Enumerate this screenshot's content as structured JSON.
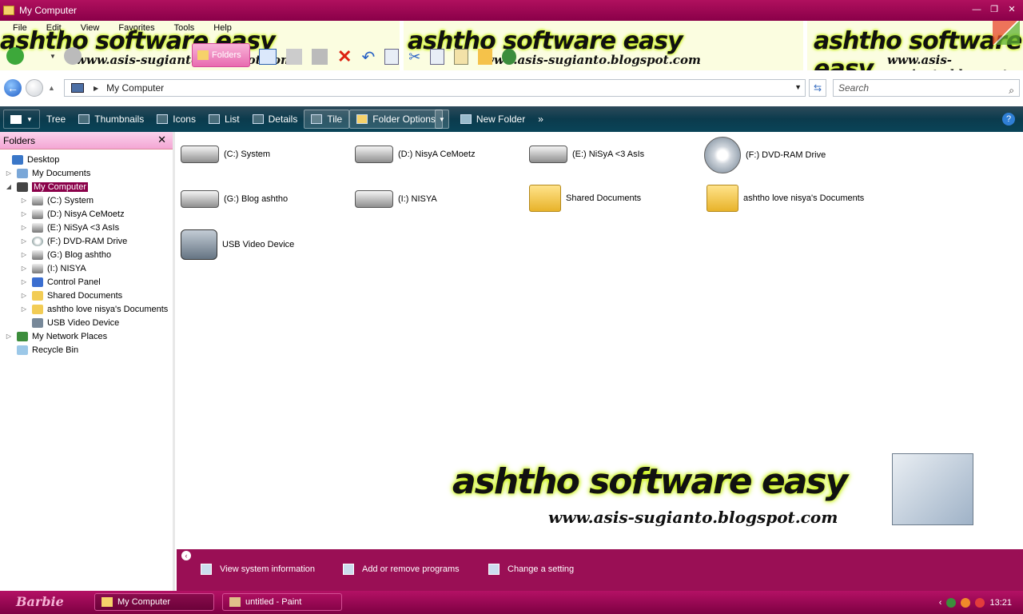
{
  "window": {
    "title": "My Computer"
  },
  "menu": [
    "File",
    "Edit",
    "View",
    "Favorites",
    "Tools",
    "Help"
  ],
  "toolbar": {
    "folders_label": "Folders"
  },
  "banner": {
    "text": "ashtho software easy",
    "url": "www.asis-sugianto.blogspot.com"
  },
  "address": {
    "path": "My Computer",
    "search_placeholder": "Search"
  },
  "commandbar": {
    "items": [
      "Tree",
      "Thumbnails",
      "Icons",
      "List",
      "Details",
      "Tile"
    ],
    "folder_options": "Folder Options",
    "new_folder": "New Folder"
  },
  "folders_pane": {
    "header": "Folders",
    "nodes": [
      {
        "label": "Desktop",
        "icon": "desktop-icon"
      },
      {
        "label": "My Documents",
        "icon": "documents-icon"
      },
      {
        "label": "My Computer",
        "icon": "computer-icon"
      },
      {
        "label": "(C:) System",
        "icon": "drive-icon"
      },
      {
        "label": "(D:) NisyA CeMoetz",
        "icon": "drive-icon"
      },
      {
        "label": "(E:) NiSyA <3 AsIs",
        "icon": "drive-icon"
      },
      {
        "label": "(F:) DVD-RAM Drive",
        "icon": "dvd-icon"
      },
      {
        "label": "(G:) Blog ashtho",
        "icon": "drive-icon"
      },
      {
        "label": "(I:) NISYA",
        "icon": "drive-icon"
      },
      {
        "label": "Control Panel",
        "icon": "control-panel-icon"
      },
      {
        "label": "Shared Documents",
        "icon": "folder-icon"
      },
      {
        "label": "ashtho love nisya's Documents",
        "icon": "folder-icon"
      },
      {
        "label": "USB Video Device",
        "icon": "camera-icon"
      },
      {
        "label": "My Network Places",
        "icon": "network-icon"
      },
      {
        "label": "Recycle Bin",
        "icon": "recycle-bin-icon"
      }
    ]
  },
  "main": {
    "items": [
      {
        "label": "(C:) System",
        "icon": "drive-icon"
      },
      {
        "label": "(D:) NisyA CeMoetz",
        "icon": "drive-icon"
      },
      {
        "label": "(E:) NiSyA <3 AsIs",
        "icon": "drive-icon"
      },
      {
        "label": "(F:) DVD-RAM Drive",
        "icon": "dvd-icon"
      },
      {
        "label": "(G:) Blog ashtho",
        "icon": "drive-icon"
      },
      {
        "label": "(I:) NISYA",
        "icon": "drive-icon"
      },
      {
        "label": "Shared Documents",
        "icon": "shared-folder-icon"
      },
      {
        "label": "ashtho love nisya's Documents",
        "icon": "folder-icon"
      },
      {
        "label": "USB Video Device",
        "icon": "camera-icon"
      }
    ]
  },
  "details_bar": {
    "tasks": [
      "View system information",
      "Add or remove programs",
      "Change a setting"
    ]
  },
  "taskbar": {
    "start_label": "Barbie",
    "buttons": [
      "My Computer",
      "untitled - Paint"
    ],
    "clock": "13:21"
  },
  "colors": {
    "accent": "#8a0049",
    "command_bar": "#0b3b4d",
    "banner_glow": "#c6f000"
  }
}
